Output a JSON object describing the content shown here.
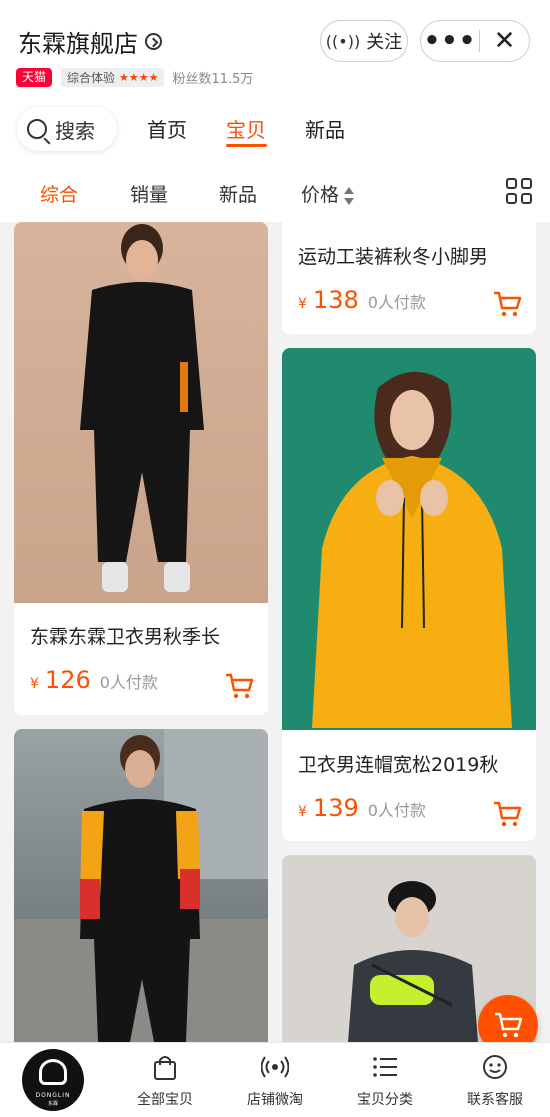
{
  "header": {
    "shop_name": "东霖旗舰店",
    "follow_label": "关注",
    "more_label": "•••",
    "close_label": "✕"
  },
  "meta": {
    "tmall_badge": "天猫",
    "rating_label": "综合体验",
    "rating_stars": "★★★★",
    "fans": "粉丝数11.5万"
  },
  "nav": {
    "search_label": "搜索",
    "tabs": [
      "首页",
      "宝贝",
      "新品"
    ],
    "active_tab": "宝贝"
  },
  "sort": {
    "options": [
      "综合",
      "销量",
      "新品",
      "价格"
    ],
    "active": "综合"
  },
  "products": [
    {
      "title": "东霖东霖卫衣男秋季长",
      "currency": "¥",
      "price": "126",
      "paid": "0人付款"
    },
    {
      "title": "运动工装裤秋冬小脚男",
      "currency": "¥",
      "price": "138",
      "paid": "0人付款"
    },
    {
      "title": "卫衣男连帽宽松2019秋",
      "currency": "¥",
      "price": "139",
      "paid": "0人付款"
    }
  ],
  "bottom_nav": {
    "brand": "DONGLIN",
    "brand_cn": "东霖",
    "items": [
      "全部宝贝",
      "店铺微淘",
      "宝贝分类",
      "联系客服"
    ]
  },
  "colors": {
    "accent": "#ff5000",
    "tmall": "#ff0036"
  }
}
